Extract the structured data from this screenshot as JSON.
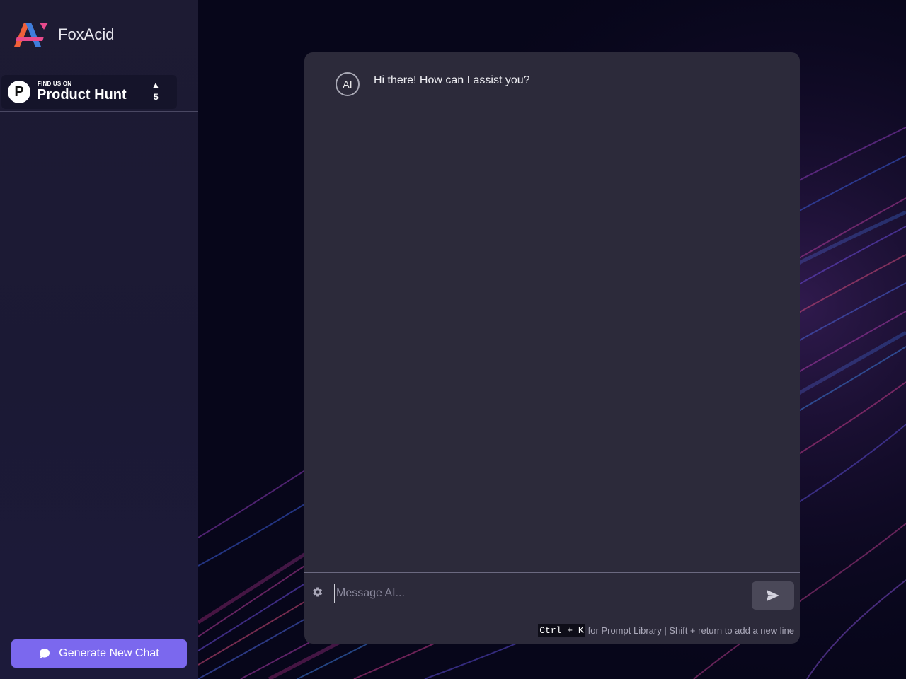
{
  "app": {
    "name": "FoxAcid"
  },
  "product_hunt": {
    "find_label": "FIND US ON",
    "name": "Product Hunt",
    "letter": "P",
    "upvote_count": "5"
  },
  "sidebar": {
    "new_chat_label": "Generate New Chat"
  },
  "chat": {
    "avatar_label": "AI",
    "messages": [
      {
        "sender": "AI",
        "text": "Hi there! How can I assist you?"
      }
    ],
    "input": {
      "placeholder": "Message AI...",
      "value": ""
    },
    "hint": {
      "shortcut": "Ctrl + K",
      "text": "for Prompt Library | Shift + return to add a new line"
    }
  },
  "colors": {
    "accent": "#7b68ee",
    "panel": "#2c2a3a",
    "sidebar": "#1d1b33",
    "logo_orange": "#f0603a",
    "logo_blue": "#3f7ddb",
    "logo_pink": "#e84a8c"
  },
  "icons": {
    "logo": "foxacid-logo",
    "chat": "chat-bubble-icon",
    "settings": "gear-icon",
    "send": "send-icon",
    "upvote": "upvote-triangle-icon"
  }
}
